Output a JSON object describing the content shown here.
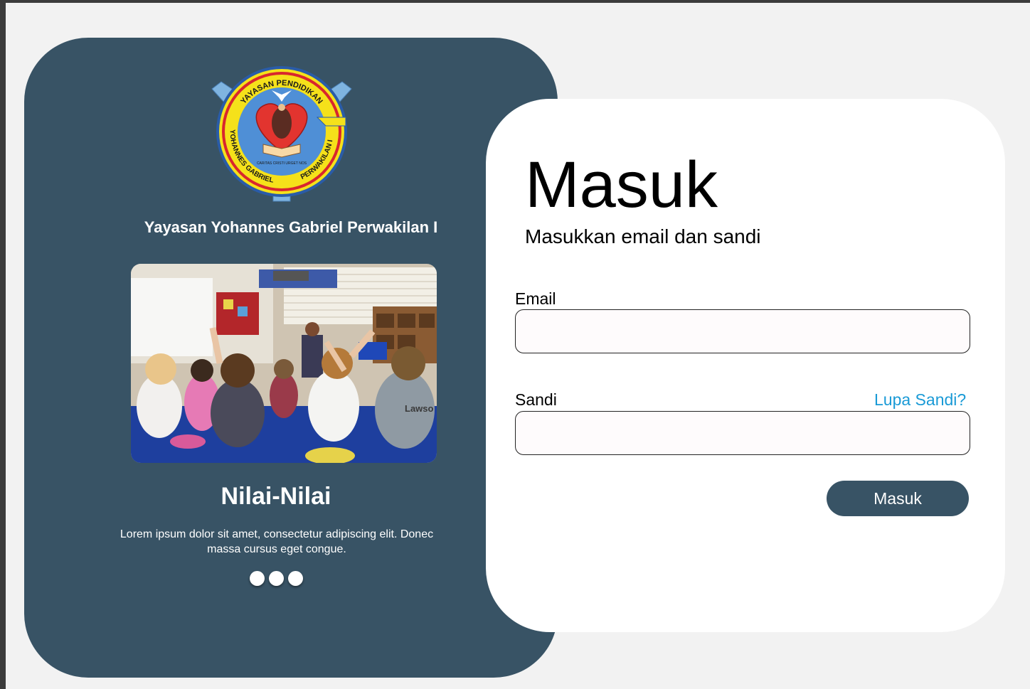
{
  "left_panel": {
    "logo": {
      "text_top": "YAYASAN PENDIDIKAN",
      "text_left": "YOHANNES GABRIEL",
      "text_right": "PERWAKILAN I",
      "motto": "CARITAS CRISTI URGET NOS"
    },
    "org_name": "Yayasan Yohannes Gabriel Perwakilan I",
    "slide": {
      "title": "Nilai-Nilai",
      "description": "Lorem ipsum dolor sit amet, consectetur adipiscing elit. Donec massa cursus eget congue.",
      "dot_count": 3
    },
    "photo_caption": "Lawso"
  },
  "login_form": {
    "title": "Masuk",
    "subtitle": "Masukkan email dan sandi",
    "email": {
      "label": "Email",
      "value": "",
      "placeholder": ""
    },
    "password": {
      "label": "Sandi",
      "value": "",
      "placeholder": ""
    },
    "forgot_password": "Lupa Sandi?",
    "submit_label": "Masuk"
  },
  "colors": {
    "panel": "#385365",
    "link": "#1a9ad6",
    "background": "#f2f2f2"
  }
}
